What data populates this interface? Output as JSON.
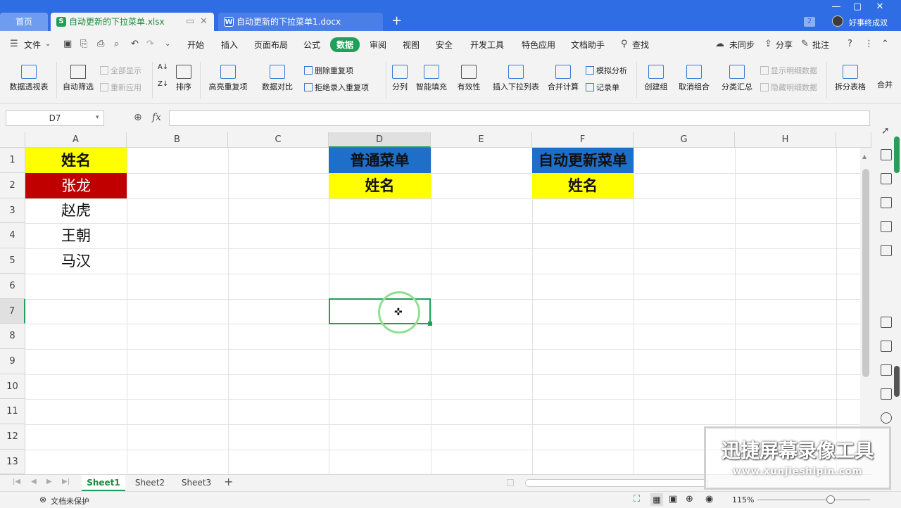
{
  "tabs": {
    "home": "首页",
    "doc1": "自动更新的下拉菜单.xlsx",
    "doc2": "自动更新的下拉菜单1.docx",
    "add": "+",
    "badge": "2",
    "user": "好事终成双"
  },
  "menu": {
    "file": "文件",
    "items": [
      "开始",
      "插入",
      "页面布局",
      "公式",
      "数据",
      "审阅",
      "视图",
      "安全",
      "开发工具",
      "特色应用",
      "文档助手"
    ],
    "active": "数据",
    "search": "查找",
    "sync": "未同步",
    "share": "分享",
    "comment": "批注"
  },
  "ribbon": {
    "pivot": "数据透视表",
    "autofilter": "自动筛选",
    "show_all": "全部显示",
    "reapply": "重新应用",
    "sort": "排序",
    "highlight_dup": "高亮重复项",
    "compare": "数据对比",
    "remove_dup": "删除重复项",
    "reject_dup": "拒绝录入重复项",
    "split_col": "分列",
    "smart_fill": "智能填充",
    "validity": "有效性",
    "insert_dropdown": "插入下拉列表",
    "merge_calc": "合并计算",
    "what_if": "模拟分析",
    "record": "记录单",
    "create_group": "创建组",
    "ungroup": "取消组合",
    "subtotal": "分类汇总",
    "show_detail": "显示明细数据",
    "hide_detail": "隐藏明细数据",
    "split_table": "拆分表格",
    "merge_more": "合并"
  },
  "formula": {
    "cell_ref": "D7",
    "fx": "fx",
    "content": ""
  },
  "grid": {
    "columns": [
      "A",
      "B",
      "C",
      "D",
      "E",
      "F",
      "G",
      "H"
    ],
    "rows": [
      "1",
      "2",
      "3",
      "4",
      "5",
      "6",
      "7",
      "8",
      "9",
      "10",
      "11",
      "12",
      "13"
    ],
    "A1": "姓名",
    "A2": "张龙",
    "A3": "赵虎",
    "A4": "王朝",
    "A5": "马汉",
    "D1": "普通菜单",
    "D2": "姓名",
    "F1": "自动更新菜单",
    "F2": "姓名",
    "selected": "D7"
  },
  "sheets": [
    "Sheet1",
    "Sheet2",
    "Sheet3"
  ],
  "status": {
    "protect": "文档未保护",
    "zoom": "115%"
  },
  "watermark": {
    "title": "迅捷屏幕录像工具",
    "url": "www.xunjieshipin.com"
  },
  "colors": {
    "accent": "#1fa05a",
    "header_yellow": "#ffff00",
    "header_blue": "#1e6fc9",
    "red_cell": "#c00000"
  }
}
